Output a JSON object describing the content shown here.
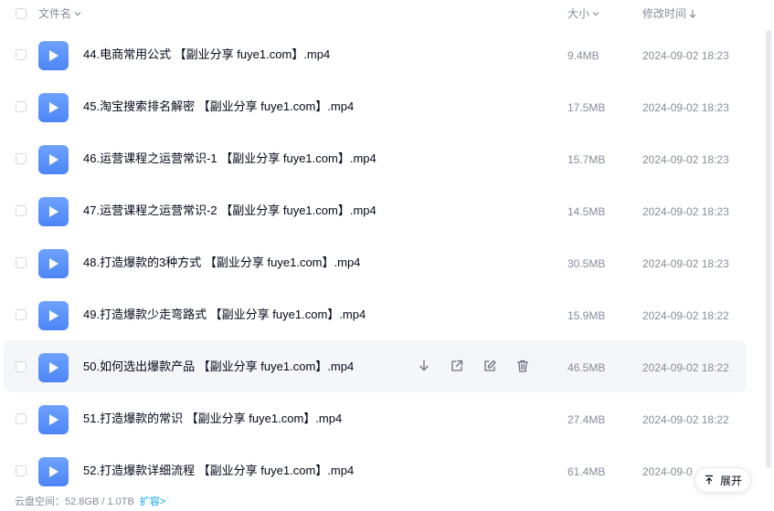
{
  "header": {
    "name_label": "文件名",
    "size_label": "大小",
    "time_label": "修改时间"
  },
  "rows": [
    {
      "name": "44.电商常用公式 【副业分享 fuye1.com】.mp4",
      "size": "9.4MB",
      "time": "2024-09-02 18:23"
    },
    {
      "name": "45.淘宝搜索排名解密 【副业分享 fuye1.com】.mp4",
      "size": "17.5MB",
      "time": "2024-09-02 18:23"
    },
    {
      "name": "46.运营课程之运营常识-1 【副业分享 fuye1.com】.mp4",
      "size": "15.7MB",
      "time": "2024-09-02 18:23"
    },
    {
      "name": "47.运营课程之运营常识-2 【副业分享 fuye1.com】.mp4",
      "size": "14.5MB",
      "time": "2024-09-02 18:23"
    },
    {
      "name": "48.打造爆款的3种方式 【副业分享 fuye1.com】.mp4",
      "size": "30.5MB",
      "time": "2024-09-02 18:23"
    },
    {
      "name": "49.打造爆款少走弯路式 【副业分享 fuye1.com】.mp4",
      "size": "15.9MB",
      "time": "2024-09-02 18:22"
    },
    {
      "name": "50.如何选出爆款产品 【副业分享 fuye1.com】.mp4",
      "size": "46.5MB",
      "time": "2024-09-02 18:22"
    },
    {
      "name": "51.打造爆款的常识 【副业分享 fuye1.com】.mp4",
      "size": "27.4MB",
      "time": "2024-09-02 18:22"
    },
    {
      "name": "52.打造爆款详细流程 【副业分享 fuye1.com】.mp4",
      "size": "61.4MB",
      "time": "2024-09-0"
    }
  ],
  "hover_row_index": 6,
  "footer": {
    "space_text": "云盘空间：52.8GB / 1.0TB",
    "expand_link": "扩容>"
  },
  "expand_button": {
    "label": "展开"
  },
  "colors": {
    "accent": "#06a7ff",
    "icon_blue": "#4e85f6",
    "text_secondary": "#878c9c",
    "hover_bg": "#f5f6f9"
  },
  "icons": {
    "file": "video-file-icon",
    "download": "download-icon",
    "share": "share-icon",
    "rename": "edit-icon",
    "delete": "trash-icon",
    "expand": "upload-arrow-icon"
  }
}
